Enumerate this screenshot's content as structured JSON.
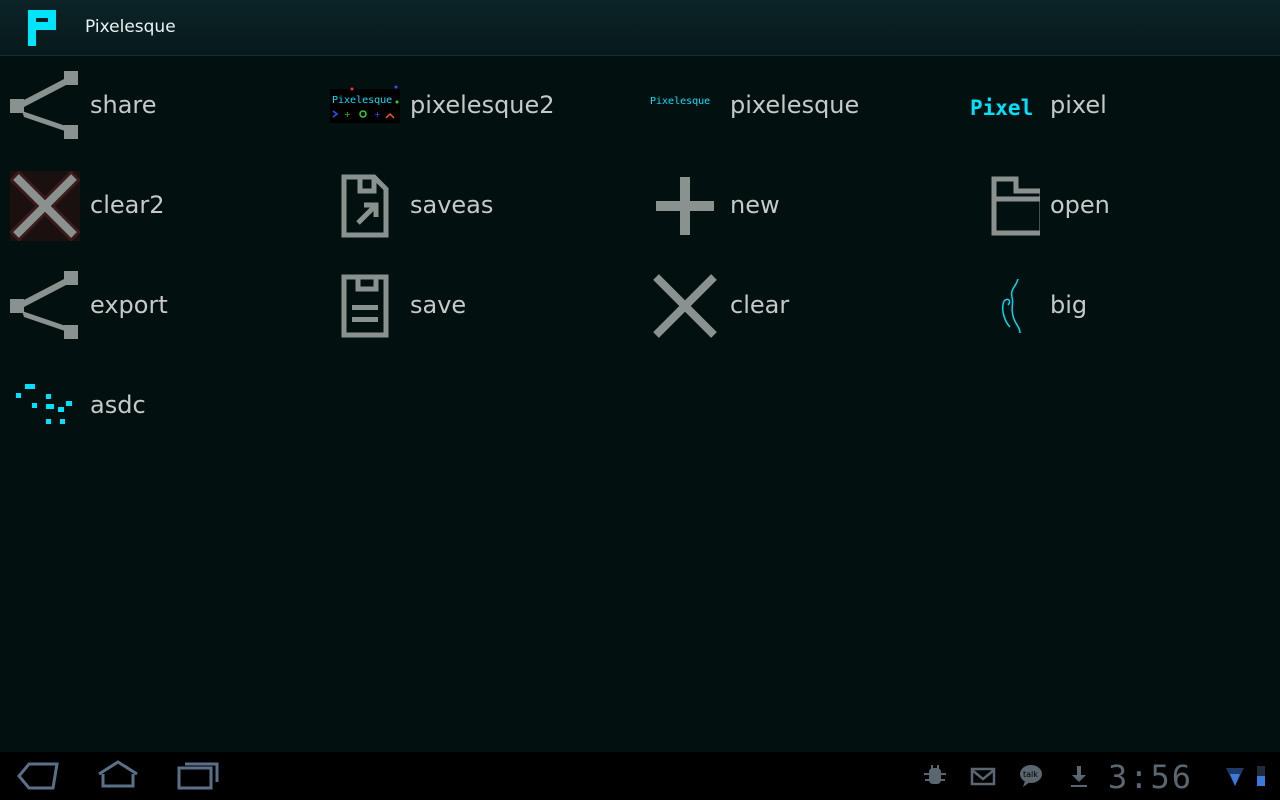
{
  "app": {
    "title": "Pixelesque"
  },
  "items": [
    {
      "label": "share",
      "icon": "share-icon"
    },
    {
      "label": "pixelesque2",
      "icon": "pixelesque2-thumbnail-icon"
    },
    {
      "label": "pixelesque",
      "icon": "pixelesque-thumbnail-icon"
    },
    {
      "label": "pixel",
      "icon": "pixel-thumbnail-icon"
    },
    {
      "label": "clear2",
      "icon": "clear2-x-icon"
    },
    {
      "label": "saveas",
      "icon": "save-as-icon"
    },
    {
      "label": "new",
      "icon": "plus-icon"
    },
    {
      "label": "open",
      "icon": "folder-icon"
    },
    {
      "label": "export",
      "icon": "share-icon"
    },
    {
      "label": "save",
      "icon": "save-icon"
    },
    {
      "label": "clear",
      "icon": "x-icon"
    },
    {
      "label": "big",
      "icon": "big-thumbnail-icon"
    },
    {
      "label": "asdc",
      "icon": "asdc-thumbnail-icon"
    }
  ],
  "thumbnails": {
    "pixelesque2_text": "Pixelesque",
    "pixelesque_text": "Pixelesque",
    "pixel_text": "Pixel"
  },
  "statusbar": {
    "time": "3:56"
  },
  "colors": {
    "accent": "#00e0ff",
    "icon_gray": "#8a9290",
    "label": "#c6c9c9",
    "background": "#021010"
  }
}
